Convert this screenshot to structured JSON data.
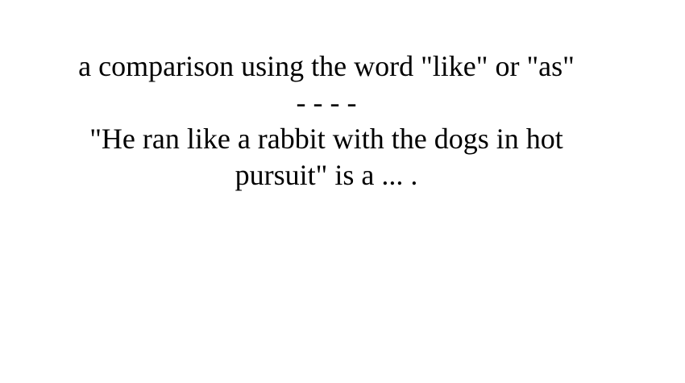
{
  "card": {
    "definition": "a comparison using the word \"like\" or \"as\"",
    "separator": "- - - -",
    "question": "\"He ran like a rabbit with the dogs in hot pursuit\" is a ... ."
  }
}
